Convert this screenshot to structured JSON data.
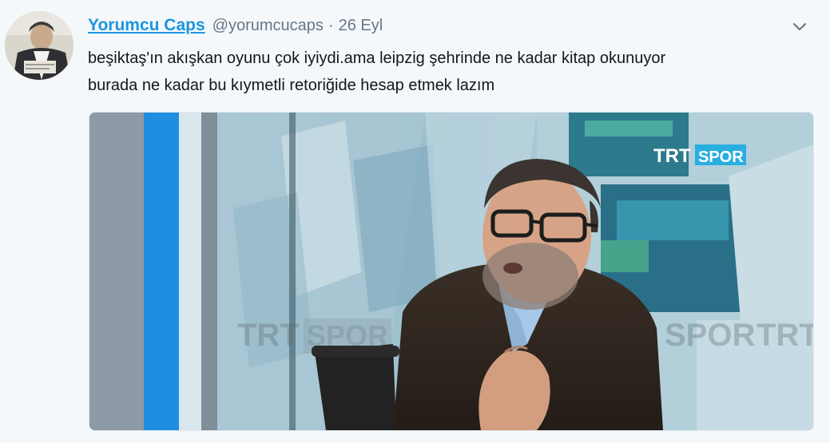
{
  "tweet": {
    "display_name": "Yorumcu Caps",
    "handle": "@yorumcucaps",
    "separator": "·",
    "timestamp": "26 Eyl",
    "text_lines": [
      "beşiktaş'ın akışkan oyunu çok iyiydi.ama leipzig şehrinde ne kadar kitap okunuyor",
      "burada ne kadar bu kıymetli retoriğide hesap etmek lazım"
    ]
  },
  "media": {
    "logo": {
      "trt": "TRT",
      "spor": "SPOR"
    },
    "watermark": {
      "trt": "TRT",
      "spor": "SPOR"
    }
  },
  "colors": {
    "accent": "#1b95e0",
    "muted": "#657786",
    "background": "#f5f8fa"
  },
  "icons": {
    "caret": "chevron-down-icon"
  }
}
